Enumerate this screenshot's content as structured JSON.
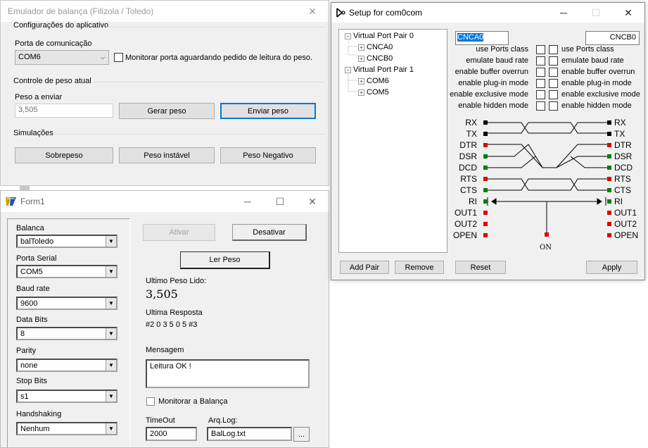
{
  "emulator": {
    "title": "Emulador de balança (Filizola / Toledo)",
    "group_config": "Configurações do aplicativo",
    "port_label": "Porta de comunicação",
    "port_value": "COM6",
    "monitor_label": "Monitorar porta aguardando pedido de leitura do peso.",
    "group_control": "Controle de peso atual",
    "weight_label": "Peso a enviar",
    "weight_value": "3,505",
    "generate_btn": "Gerar peso",
    "send_btn": "Enviar peso",
    "group_sim": "Simulações",
    "overweight_btn": "Sobrepeso",
    "unstable_btn": "Peso instável",
    "negative_btn": "Peso Negativo"
  },
  "form1": {
    "title": "Form1",
    "balanca_label": "Balanca",
    "balanca_value": "balToledo",
    "porta_label": "Porta Serial",
    "porta_value": "COM5",
    "baud_label": "Baud rate",
    "baud_value": "9600",
    "databits_label": "Data Bits",
    "databits_value": "8",
    "parity_label": "Parity",
    "parity_value": "none",
    "stopbits_label": "Stop Bits",
    "stopbits_value": "s1",
    "handshaking_label": "Handshaking",
    "handshaking_value": "Nenhum",
    "ativar_btn": "Ativar",
    "desativar_btn": "Desativar",
    "ler_btn": "Ler Peso",
    "ultimo_label": "Ultimo Peso Lido:",
    "ultimo_value": "3,505",
    "resposta_label": "Ultima Resposta",
    "resposta_value": "#2 0 3 5 0 5 #3",
    "mensagem_label": "Mensagem",
    "mensagem_value": "Leitura OK !",
    "monitorar_label": "Monitorar a Balança",
    "timeout_label": "TimeOut",
    "timeout_value": "2000",
    "arqlog_label": "Arq.Log:",
    "arqlog_value": "BalLog.txt",
    "browse_btn": "..."
  },
  "setup": {
    "title": "Setup for com0com",
    "tree": {
      "pair0": "Virtual Port Pair 0",
      "cnca0": "CNCA0",
      "cncb0": "CNCB0",
      "pair1": "Virtual Port Pair 1",
      "com6": "COM6",
      "com5": "COM5"
    },
    "left_port": "CNCA0",
    "right_port": "CNCB0",
    "options": [
      "use Ports class",
      "emulate baud rate",
      "enable buffer overrun",
      "enable plug-in mode",
      "enable exclusive mode",
      "enable hidden mode"
    ],
    "signals_left": [
      "RX",
      "TX",
      "DTR",
      "DSR",
      "DCD",
      "RTS",
      "CTS",
      "RI",
      "OUT1",
      "OUT2",
      "OPEN"
    ],
    "signals_right": [
      "RX",
      "TX",
      "DTR",
      "DSR",
      "DCD",
      "RTS",
      "CTS",
      "RI",
      "OUT1",
      "OUT2",
      "OPEN"
    ],
    "on_label": "ON",
    "add_btn": "Add Pair",
    "remove_btn": "Remove",
    "reset_btn": "Reset",
    "apply_btn": "Apply",
    "colors": {
      "black": "#000000",
      "red": "#e00000",
      "green": "#008000"
    }
  }
}
